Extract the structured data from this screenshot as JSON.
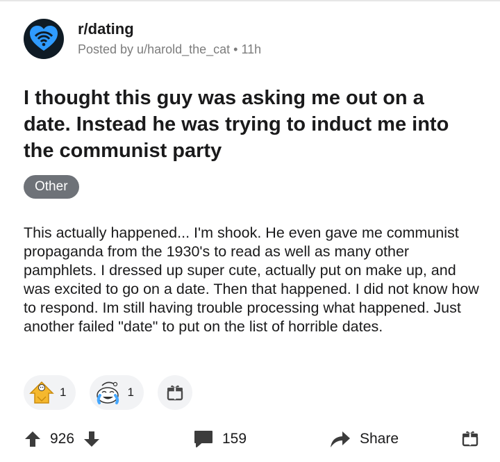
{
  "subreddit": {
    "name": "r/dating",
    "posted_by": "Posted by u/harold_the_cat",
    "age": "11h"
  },
  "post": {
    "title": "I thought this guy was asking me out on a date. Instead he was trying to induct me into the communist party",
    "flair": "Other",
    "body": "This actually happened... I'm shook. He even gave me communist propaganda from the 1930's to read as well as many other pamphlets. I dressed up super cute, actually put on make up, and was excited to go on a date. Then that happened. I did not know how to respond. Im still having trouble processing what happened. Just another failed \"date\" to put on the list of horrible dates."
  },
  "awards": [
    {
      "icon": "wholesome-award-icon",
      "count": "1"
    },
    {
      "icon": "laughing-award-icon",
      "count": "1"
    }
  ],
  "actions": {
    "vote_count": "926",
    "comment_count": "159",
    "share_label": "Share"
  },
  "colors": {
    "text": "#1a1a1b",
    "meta": "#7c7c7c",
    "flair_bg": "#6e7278",
    "subreddit_icon_bg": "#0f1b25",
    "subreddit_icon_fg": "#2f9bff"
  }
}
